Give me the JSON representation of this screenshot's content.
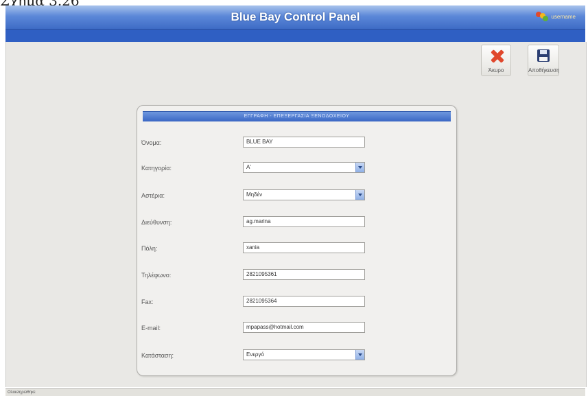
{
  "caption": "Σχήμα 3.26",
  "header": {
    "title": "Blue Bay Control Panel",
    "user_label": "username"
  },
  "toolbar": {
    "cancel_label": "Άκυρο",
    "save_label": "Αποθήκευση"
  },
  "form": {
    "header": "ΕΓΓΡΑΦΗ - ΕΠΕΞΕΡΓΑΣΙΑ ΞΕΝΟΔΟΧΕΙΟΥ",
    "fields": [
      {
        "label": "Όνομα:",
        "value": "BLUE BAY",
        "type": "input"
      },
      {
        "label": "Κατηγορία:",
        "value": "Α'",
        "type": "select"
      },
      {
        "label": "Αστέρια:",
        "value": "Μηδέν",
        "type": "select"
      },
      {
        "label": "Διεύθυνση:",
        "value": "ag.marina",
        "type": "input"
      },
      {
        "label": "Πόλη:",
        "value": "xania",
        "type": "input"
      },
      {
        "label": "Τηλέφωνο:",
        "value": "2821095361",
        "type": "input"
      },
      {
        "label": "Fax:",
        "value": "2821095364",
        "type": "input"
      },
      {
        "label": "E-mail:",
        "value": "mpapass@hotmail.com",
        "type": "input"
      },
      {
        "label": "Κατάσταση:",
        "value": "Ενεργό",
        "type": "select"
      }
    ]
  },
  "status": {
    "text": "Ολοκληρώθηκε"
  },
  "colors": {
    "titlebar": "#5c88d8",
    "bluebar": "#2f5fc3",
    "panel_header": "#3a67c4"
  }
}
